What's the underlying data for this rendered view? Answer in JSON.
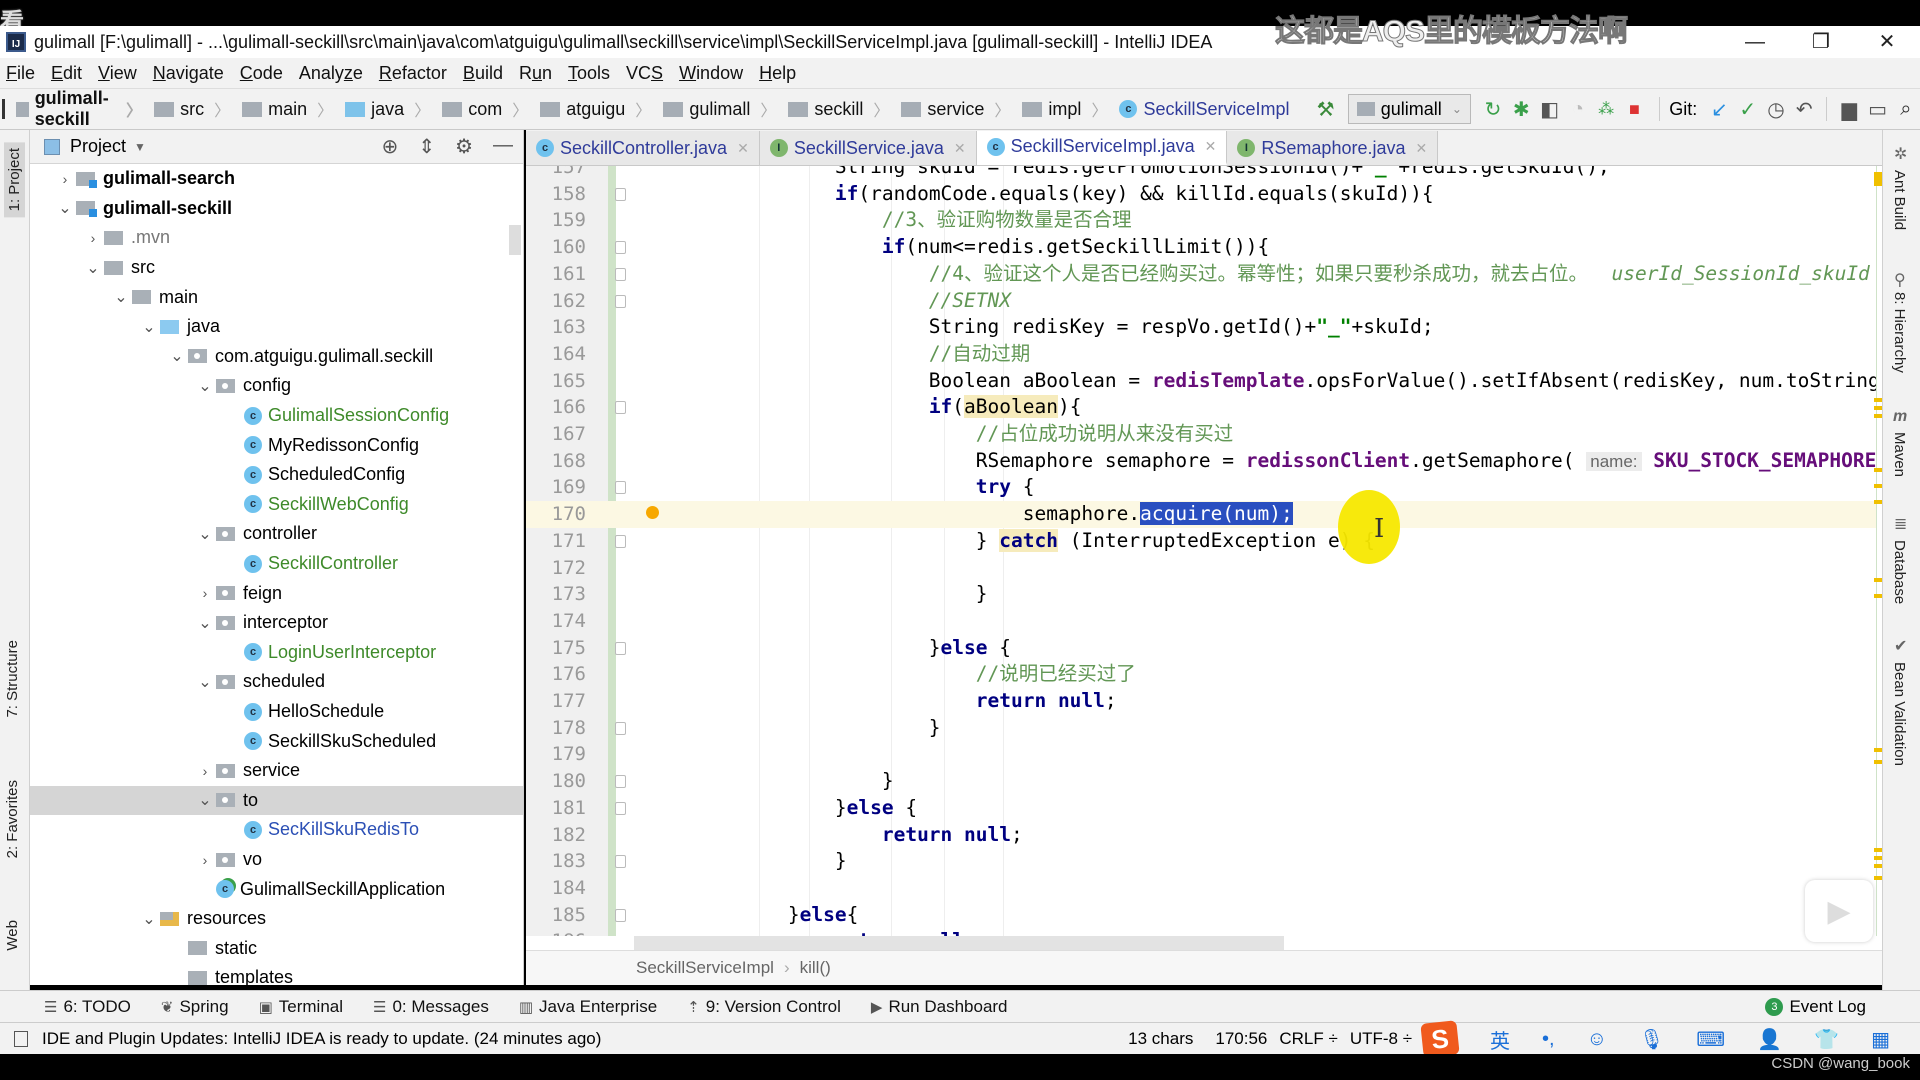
{
  "overlay": {
    "corner_char": "看",
    "subtitle": "这都是AQS里的模板方法啊",
    "watermark": "CSDN @wang_book"
  },
  "window": {
    "title": "gulimall [F:\\gulimall] - ...\\gulimall-seckill\\src\\main\\java\\com\\atguigu\\gulimall\\seckill\\service\\impl\\SeckillServiceImpl.java [gulimall-seckill] - IntelliJ IDEA",
    "app_icon": "IJ",
    "minimize": "—",
    "restore": "❐",
    "close": "✕"
  },
  "menu": [
    {
      "mn": "F",
      "rest": "ile"
    },
    {
      "mn": "E",
      "rest": "dit"
    },
    {
      "mn": "V",
      "rest": "iew"
    },
    {
      "mn": "N",
      "rest": "avigate"
    },
    {
      "mn": "C",
      "rest": "ode"
    },
    {
      "pre": "Analy",
      "mn": "z",
      "rest": "e"
    },
    {
      "mn": "R",
      "rest": "efactor"
    },
    {
      "mn": "B",
      "rest": "uild"
    },
    {
      "pre": "R",
      "mn": "u",
      "rest": "n"
    },
    {
      "mn": "T",
      "rest": "ools"
    },
    {
      "pre": "VC",
      "mn": "S",
      "rest": ""
    },
    {
      "mn": "W",
      "rest": "indow"
    },
    {
      "mn": "H",
      "rest": "elp"
    }
  ],
  "navbar": {
    "crumbs": [
      "gulimall-seckill",
      "src",
      "main",
      "java",
      "com",
      "atguigu",
      "gulimall",
      "seckill",
      "service",
      "impl",
      "SeckillServiceImpl"
    ],
    "run_config": "gulimall",
    "git_label": "Git:"
  },
  "left_strip": {
    "project": "1: Project",
    "structure": "7: Structure",
    "favorites": "2: Favorites",
    "web": "Web"
  },
  "project_panel": {
    "title": "Project",
    "tree": [
      {
        "label": "gulimall-search",
        "depth": 1,
        "arrow": "›",
        "icon": "module",
        "style": "bold"
      },
      {
        "label": "gulimall-seckill",
        "depth": 1,
        "arrow": "⌄",
        "icon": "module",
        "style": "bold"
      },
      {
        "label": ".mvn",
        "depth": 2,
        "arrow": "›",
        "icon": "folder",
        "style": "grey"
      },
      {
        "label": "src",
        "depth": 2,
        "arrow": "⌄",
        "icon": "folder",
        "style": ""
      },
      {
        "label": "main",
        "depth": 3,
        "arrow": "⌄",
        "icon": "folder",
        "style": ""
      },
      {
        "label": "java",
        "depth": 4,
        "arrow": "⌄",
        "icon": "folder-blue",
        "style": ""
      },
      {
        "label": "com.atguigu.gulimall.seckill",
        "depth": 5,
        "arrow": "⌄",
        "icon": "package",
        "style": ""
      },
      {
        "label": "config",
        "depth": 6,
        "arrow": "⌄",
        "icon": "package",
        "style": ""
      },
      {
        "label": "GulimallSessionConfig",
        "depth": 7,
        "arrow": "",
        "icon": "class",
        "style": "green"
      },
      {
        "label": "MyRedissonConfig",
        "depth": 7,
        "arrow": "",
        "icon": "class",
        "style": ""
      },
      {
        "label": "ScheduledConfig",
        "depth": 7,
        "arrow": "",
        "icon": "class",
        "style": ""
      },
      {
        "label": "SeckillWebConfig",
        "depth": 7,
        "arrow": "",
        "icon": "class",
        "style": "green"
      },
      {
        "label": "controller",
        "depth": 6,
        "arrow": "⌄",
        "icon": "package",
        "style": ""
      },
      {
        "label": "SeckillController",
        "depth": 7,
        "arrow": "",
        "icon": "class",
        "style": "green"
      },
      {
        "label": "feign",
        "depth": 6,
        "arrow": "›",
        "icon": "package",
        "style": ""
      },
      {
        "label": "interceptor",
        "depth": 6,
        "arrow": "⌄",
        "icon": "package",
        "style": ""
      },
      {
        "label": "LoginUserInterceptor",
        "depth": 7,
        "arrow": "",
        "icon": "class",
        "style": "green"
      },
      {
        "label": "scheduled",
        "depth": 6,
        "arrow": "⌄",
        "icon": "package",
        "style": ""
      },
      {
        "label": "HelloSchedule",
        "depth": 7,
        "arrow": "",
        "icon": "class",
        "style": ""
      },
      {
        "label": "SeckillSkuScheduled",
        "depth": 7,
        "arrow": "",
        "icon": "class",
        "style": ""
      },
      {
        "label": "service",
        "depth": 6,
        "arrow": "›",
        "icon": "package",
        "style": ""
      },
      {
        "label": "to",
        "depth": 6,
        "arrow": "⌄",
        "icon": "package",
        "style": "",
        "selected": true
      },
      {
        "label": "SecKillSkuRedisTo",
        "depth": 7,
        "arrow": "",
        "icon": "class",
        "style": "blue"
      },
      {
        "label": "vo",
        "depth": 6,
        "arrow": "›",
        "icon": "package",
        "style": ""
      },
      {
        "label": "GulimallSeckillApplication",
        "depth": 6,
        "arrow": "",
        "icon": "app",
        "style": ""
      },
      {
        "label": "resources",
        "depth": 4,
        "arrow": "⌄",
        "icon": "resources",
        "style": ""
      },
      {
        "label": "static",
        "depth": 5,
        "arrow": "",
        "icon": "folder",
        "style": ""
      },
      {
        "label": "templates",
        "depth": 5,
        "arrow": "",
        "icon": "folder",
        "style": ""
      }
    ]
  },
  "editor": {
    "tabs": [
      {
        "label": "SeckillController.java",
        "icon": "c",
        "active": false
      },
      {
        "label": "SeckillService.java",
        "icon": "i",
        "active": false
      },
      {
        "label": "SeckillServiceImpl.java",
        "icon": "c",
        "active": true
      },
      {
        "label": "RSemaphore.java",
        "icon": "i",
        "active": false
      }
    ],
    "current_line": 170,
    "lines": [
      {
        "n": 157,
        "html": "            String skuId = redis.getPromotionSessionId()+<span class=\"str\">\"_\"</span>+redis.getSkuId();"
      },
      {
        "n": 158,
        "html": "            <span class=\"kw\">if</span>(randomCode.equals(key) &amp;&amp; killId.equals(skuId)){",
        "fold": true
      },
      {
        "n": 159,
        "html": "                <span class=\"cm\">//3、验证购物数量是否合理</span>"
      },
      {
        "n": 160,
        "html": "                <span class=\"kw\">if</span>(num&lt;=redis.getSeckillLimit()){",
        "fold": true
      },
      {
        "n": 161,
        "html": "                    <span class=\"cm\">//4、验证这个人是否已经购买过。幂等性；如果只要秒杀成功，就去占位。  </span><span class=\"cmi\">userId_SessionId_skuId</span>",
        "fold": true
      },
      {
        "n": 162,
        "html": "                    <span class=\"cmi\">//SETNX</span>",
        "fold": true
      },
      {
        "n": 163,
        "html": "                    String redisKey = respVo.getId()+<span class=\"str\">\"_\"</span>+skuId;"
      },
      {
        "n": 164,
        "html": "                    <span class=\"cm\">//自动过期</span>"
      },
      {
        "n": 165,
        "html": "                    Boolean aBoolean = <span class=\"fld\">redisTemplate</span>.opsForValue().setIfAbsent(redisKey, num.toString());"
      },
      {
        "n": 166,
        "html": "                    <span class=\"kw\">if</span>(<span class=\"hl\">aBoolean</span>){",
        "fold": true
      },
      {
        "n": 167,
        "html": "                        <span class=\"cm\">//占位成功说明从来没有买过</span>"
      },
      {
        "n": 168,
        "html": "                        RSemaphore semaphore = <span class=\"fld\">redissonClient</span>.getSemaphore( <span class=\"hint\">name:</span> <span class=\"fld\">SKU_STOCK_SEMAPHORE</span>"
      },
      {
        "n": 169,
        "html": "                        <span class=\"kw\">try</span> {",
        "fold": true
      },
      {
        "n": 170,
        "html": "                            semaphore.<span class=\"selx\">acquire(num);</span>",
        "bulb": true
      },
      {
        "n": 171,
        "html": "                        } <span class=\"kw hl\">catch</span> (InterruptedException e) {",
        "fold": true
      },
      {
        "n": 172,
        "html": ""
      },
      {
        "n": 173,
        "html": "                        }"
      },
      {
        "n": 174,
        "html": ""
      },
      {
        "n": 175,
        "html": "                    }<span class=\"kw\">else</span> {",
        "fold": true
      },
      {
        "n": 176,
        "html": "                        <span class=\"cm\">//说明已经买过了</span>"
      },
      {
        "n": 177,
        "html": "                        <span class=\"kw\">return null</span>;"
      },
      {
        "n": 178,
        "html": "                    }",
        "fold": true
      },
      {
        "n": 179,
        "html": ""
      },
      {
        "n": 180,
        "html": "                }",
        "fold": true
      },
      {
        "n": 181,
        "html": "            }<span class=\"kw\">else</span> {",
        "fold": true
      },
      {
        "n": 182,
        "html": "                <span class=\"kw\">return null</span>;"
      },
      {
        "n": 183,
        "html": "            }",
        "fold": true
      },
      {
        "n": 184,
        "html": ""
      },
      {
        "n": 185,
        "html": "        }<span class=\"kw\">else</span>{",
        "fold": true
      },
      {
        "n": 186,
        "html": "            <span class=\"kw\">return null</span>;"
      }
    ],
    "breadcrumb": [
      "SeckillServiceImpl",
      "kill()"
    ]
  },
  "right_strip": [
    "Ant Build",
    "8: Hierarchy",
    "Maven",
    "Database",
    "Bean Validation"
  ],
  "bottom_tabs": [
    {
      "icon": "☰",
      "label": "6: TODO"
    },
    {
      "icon": "❦",
      "label": "Spring"
    },
    {
      "icon": "▣",
      "label": "Terminal"
    },
    {
      "icon": "☰",
      "label": "0: Messages"
    },
    {
      "icon": "▥",
      "label": "Java Enterprise"
    },
    {
      "icon": "⇡",
      "label": "9: Version Control"
    },
    {
      "icon": "▶",
      "label": "Run Dashboard"
    }
  ],
  "event_log": {
    "badge": "3",
    "label": "Event Log"
  },
  "status": {
    "message": "IDE and Plugin Updates: IntelliJ IDEA is ready to update. (24 minutes ago)",
    "chars": "13 chars",
    "position": "170:56",
    "line_sep": "CRLF ÷",
    "encoding": "UTF-8 ÷"
  },
  "ime": {
    "logo": "S",
    "lang": "英",
    "items": [
      "•,",
      "☺",
      "🎙",
      "⌨",
      "👤",
      "👕",
      "▦"
    ]
  }
}
